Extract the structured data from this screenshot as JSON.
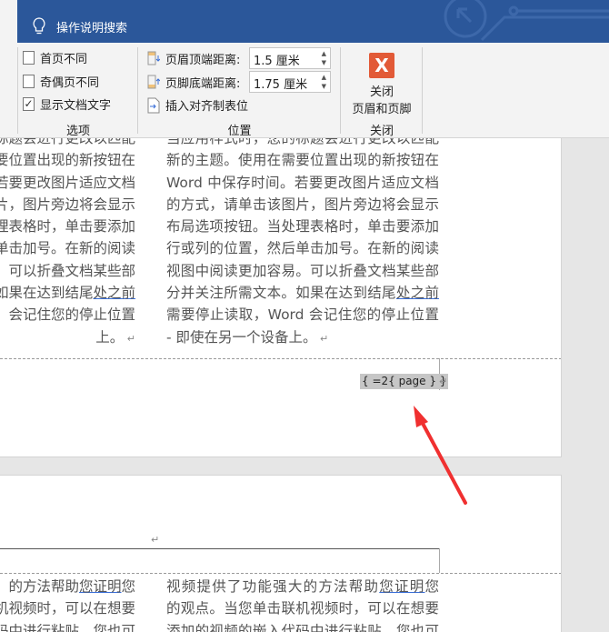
{
  "titlebar": {
    "tell_me": "操作说明搜索"
  },
  "ribbon": {
    "options": {
      "first_page_diff": "首页不同",
      "first_page_checked": false,
      "odd_even_diff": "奇偶页不同",
      "odd_even_checked": false,
      "show_doc_text": "显示文档文字",
      "show_doc_checked": true,
      "group_label": "选项"
    },
    "position": {
      "header_top_label": "页眉顶端距离:",
      "header_top_value": "1.5 厘米",
      "footer_bottom_label": "页脚底端距离:",
      "footer_bottom_value": "1.75 厘米",
      "insert_align_tab": "插入对齐制表位",
      "group_label": "位置"
    },
    "close": {
      "button_line1": "关闭",
      "button_line2": "页眉和页脚",
      "group_label": "关闭",
      "icon": "close-icon"
    }
  },
  "page1": {
    "left_lines": [
      "标题会进行更改以匹配",
      "要位置出现的新按钮在",
      "若要更改图片适应文档",
      "片，图片旁边将会显示",
      "理表格时，单击要添加",
      "单击加号。在新的阅读",
      "。可以折叠文档某些部",
      "如果在达到结尾",
      "处之前",
      "，会记住您的停止位置",
      "上。"
    ],
    "right_lines": [
      "当应用样式时，您的标题会进行更改以匹配",
      "新的主题。使用在需要位置出现的新按钮在",
      "Word 中保存时间。若要更改图片适应文档",
      "的方式，请单击该图片，图片旁边将会显示",
      "布局选项按钮。当处理表格时，单击要添加",
      "行或列的位置，然后单击加号。在新的阅读",
      "视图中阅读更加容易。可以折叠文档某些部",
      "分并关注所需文本。如果在达到结尾",
      "处之前",
      "需要停止读取，Word 会记住您的停止位置",
      "- 即使在另一个设备上。"
    ],
    "footer_field": "{ =2{ page } }"
  },
  "page2": {
    "left_lines": [
      "的方法帮助",
      "您证明",
      "您",
      "机视频时，可以在想要",
      "码中进行粘贴。您也可"
    ],
    "right_lines": [
      "视频提供了功能强大的方法帮助",
      "您证明",
      "您",
      "的观点。当您单击联机视频时，可以在想要",
      "添加的视频的嵌入代码中进行粘贴。您也可"
    ]
  },
  "colors": {
    "titlebar": "#2b579a",
    "arrow": "#f03030",
    "close_icon": "#e25a37"
  }
}
